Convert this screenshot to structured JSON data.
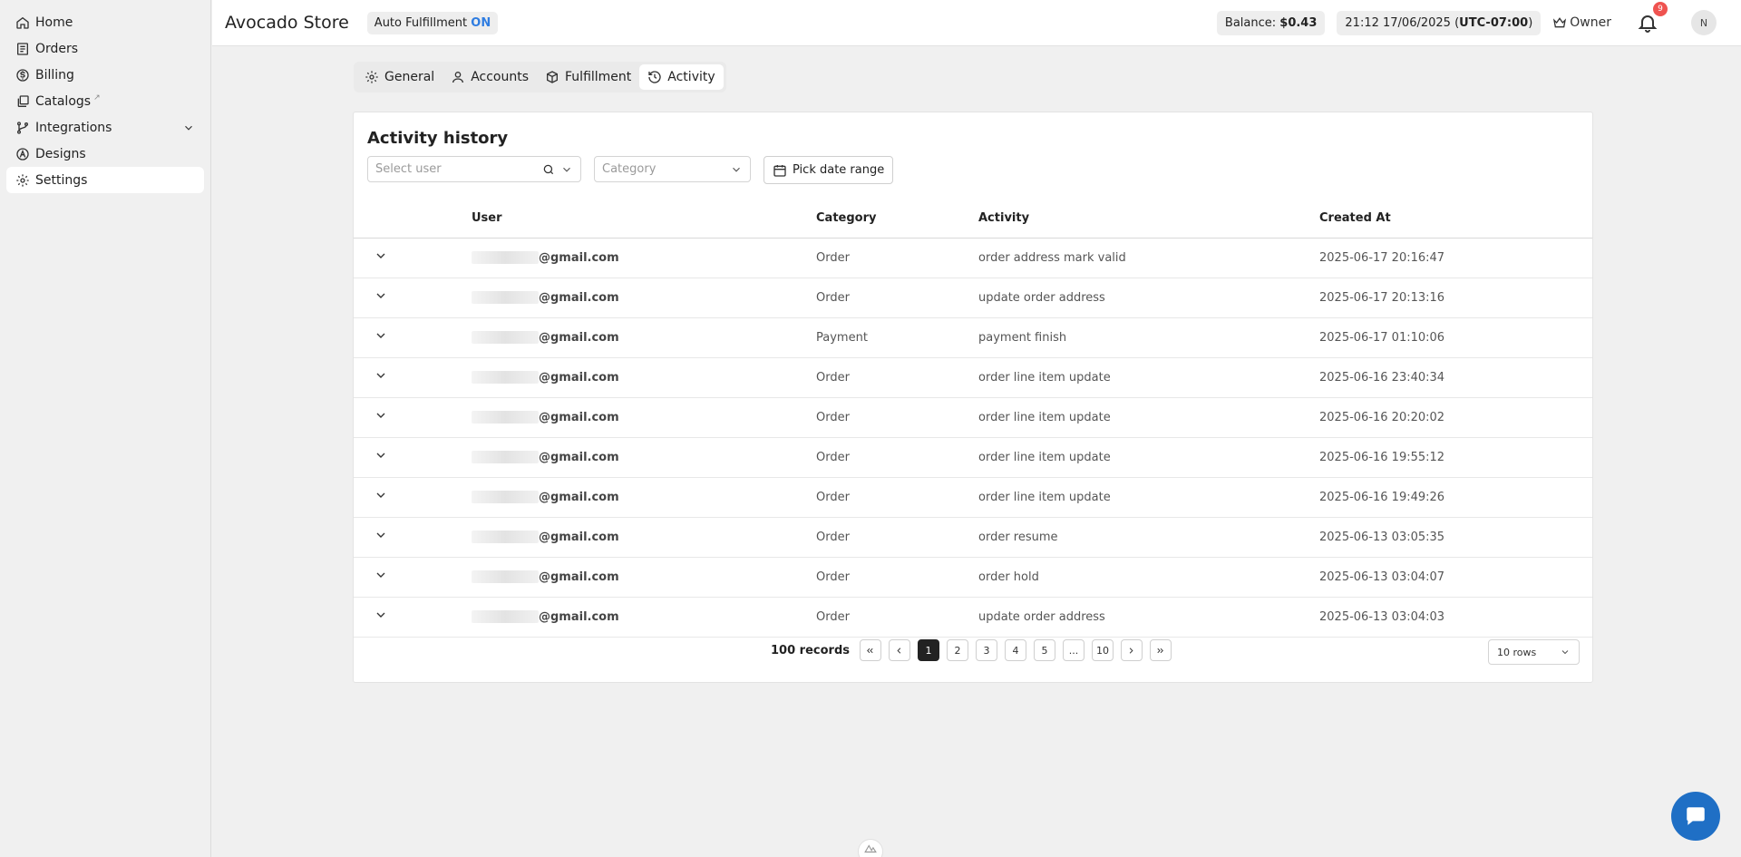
{
  "sidebar": {
    "items": [
      {
        "label": "Home",
        "icon": "home-icon"
      },
      {
        "label": "Orders",
        "icon": "orders-icon"
      },
      {
        "label": "Billing",
        "icon": "dollar-icon"
      },
      {
        "label": "Catalogs",
        "icon": "catalog-icon",
        "external_mark": "↗"
      },
      {
        "label": "Integrations",
        "icon": "branch-icon"
      },
      {
        "label": "Designs",
        "icon": "designs-icon"
      },
      {
        "label": "Settings",
        "icon": "gear-icon"
      }
    ]
  },
  "header": {
    "store_name": "Avocado Store",
    "auto_fulfillment_label": "Auto Fulfillment",
    "auto_fulfillment_state": "ON",
    "balance_label": "Balance:",
    "balance_value": "$0.43",
    "datetime": "21:12 17/06/2025",
    "timezone_open": "(",
    "timezone": "UTC-07:00",
    "timezone_close": ")",
    "owner_label": "Owner",
    "notification_count": "9",
    "avatar_initial": "N"
  },
  "tabs": [
    {
      "label": "General"
    },
    {
      "label": "Accounts"
    },
    {
      "label": "Fulfillment"
    },
    {
      "label": "Activity"
    }
  ],
  "activity": {
    "title": "Activity history",
    "user_filter_placeholder": "Select user",
    "category_filter_placeholder": "Category",
    "date_range_label": "Pick date range",
    "columns": [
      "User",
      "Category",
      "Activity",
      "Created At"
    ],
    "rows": [
      {
        "user": "@gmail.com",
        "category": "Order",
        "activity": "order address mark valid",
        "created_at": "2025-06-17 20:16:47"
      },
      {
        "user": "@gmail.com",
        "category": "Order",
        "activity": "update order address",
        "created_at": "2025-06-17 20:13:16"
      },
      {
        "user": "@gmail.com",
        "category": "Payment",
        "activity": "payment finish",
        "created_at": "2025-06-17 01:10:06"
      },
      {
        "user": "@gmail.com",
        "category": "Order",
        "activity": "order line item update",
        "created_at": "2025-06-16 23:40:34"
      },
      {
        "user": "@gmail.com",
        "category": "Order",
        "activity": "order line item update",
        "created_at": "2025-06-16 20:20:02"
      },
      {
        "user": "@gmail.com",
        "category": "Order",
        "activity": "order line item update",
        "created_at": "2025-06-16 19:55:12"
      },
      {
        "user": "@gmail.com",
        "category": "Order",
        "activity": "order line item update",
        "created_at": "2025-06-16 19:49:26"
      },
      {
        "user": "@gmail.com",
        "category": "Order",
        "activity": "order resume",
        "created_at": "2025-06-13 03:05:35"
      },
      {
        "user": "@gmail.com",
        "category": "Order",
        "activity": "order hold",
        "created_at": "2025-06-13 03:04:07"
      },
      {
        "user": "@gmail.com",
        "category": "Order",
        "activity": "update order address",
        "created_at": "2025-06-13 03:04:03"
      }
    ],
    "pagination": {
      "records_label": "100 records",
      "pages": [
        "1",
        "2",
        "3",
        "4",
        "5",
        "...",
        "10"
      ],
      "current_page": "1",
      "rows_per_page": "10 rows"
    }
  },
  "colors": {
    "accent_on": "#2f7de1",
    "notification_badge": "#ef5350",
    "chat_button": "#1f6fc5",
    "active_page": "#222222"
  }
}
